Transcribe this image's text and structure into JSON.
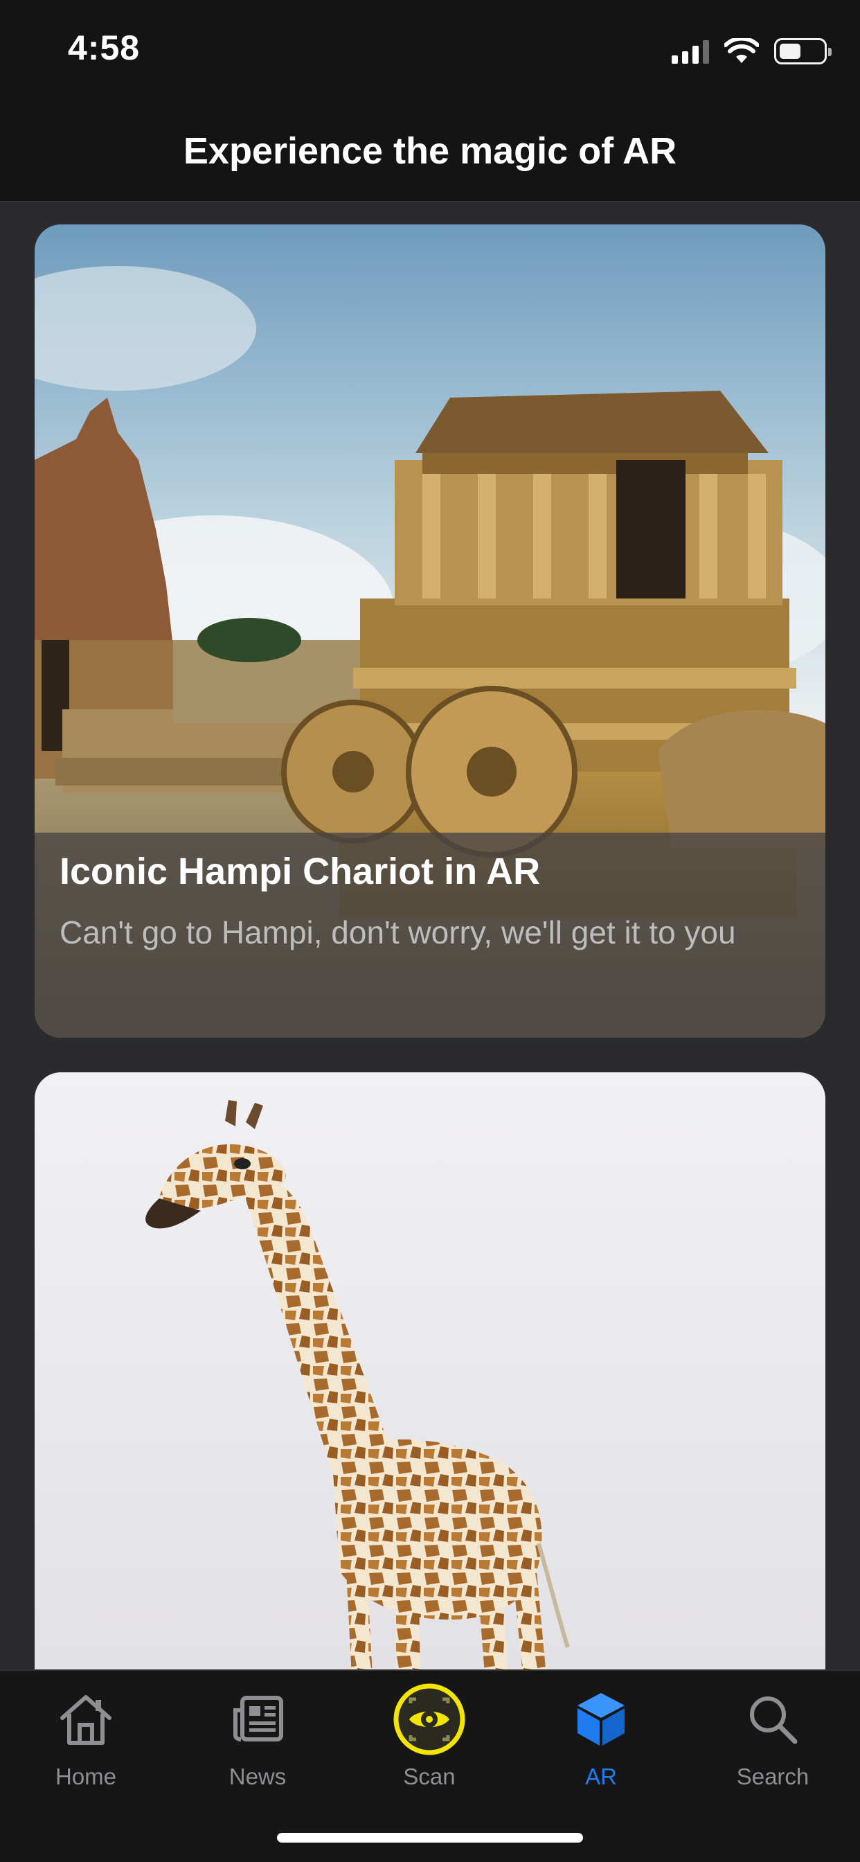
{
  "status_bar": {
    "time": "4:58",
    "icons": [
      "cellular-signal-icon",
      "wifi-icon",
      "battery-icon"
    ]
  },
  "header": {
    "title": "Experience the magic of AR"
  },
  "cards": [
    {
      "title": "Iconic Hampi Chariot in AR",
      "subtitle": "Can't go to Hampi, don't worry, we'll get it to you",
      "image": "hampi-stone-chariot-photo"
    },
    {
      "title": "",
      "subtitle": "",
      "image": "giraffe-photo"
    }
  ],
  "tab_bar": {
    "active": "AR",
    "accent_color": "#1e7bf0",
    "scan_ring_color": "#f3e500",
    "items": [
      {
        "label": "Home",
        "icon": "home-icon"
      },
      {
        "label": "News",
        "icon": "news-icon"
      },
      {
        "label": "Scan",
        "icon": "scan-eye-icon"
      },
      {
        "label": "AR",
        "icon": "ar-cube-icon"
      },
      {
        "label": "Search",
        "icon": "search-icon"
      }
    ]
  }
}
